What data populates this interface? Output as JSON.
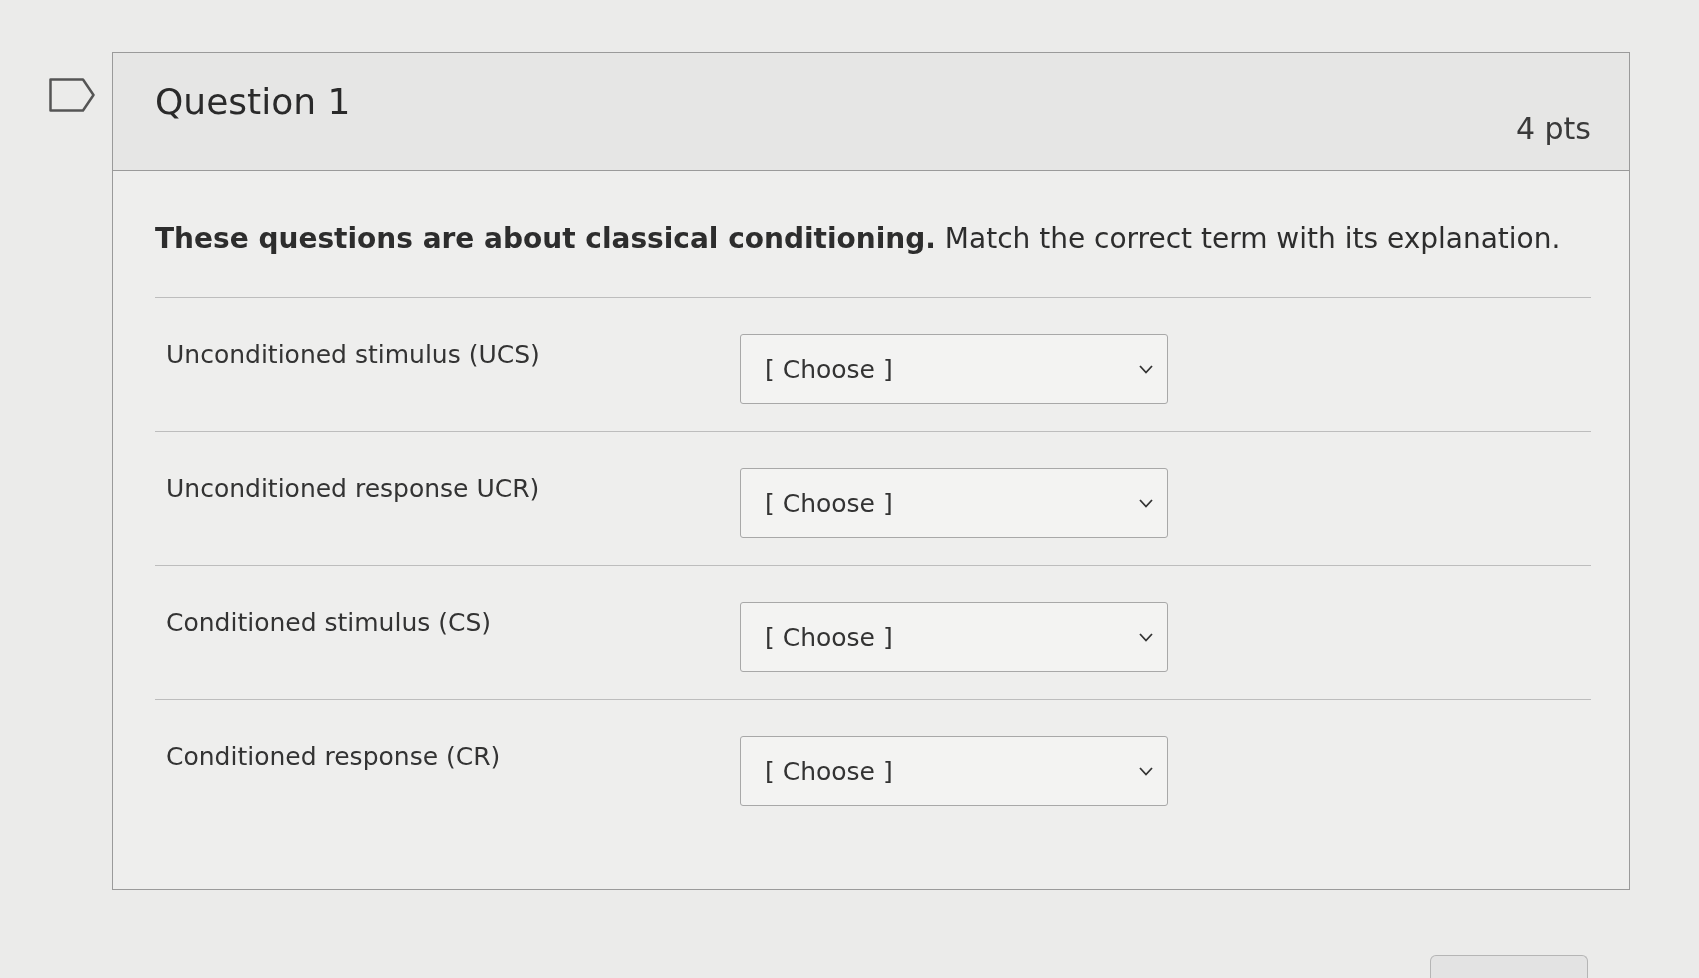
{
  "question": {
    "title": "Question 1",
    "points": "4 pts",
    "flagged": false
  },
  "prompt": "**These questions are about classical conditioning.** Match the correct term with its explanation.",
  "matches": [
    {
      "term": "Unconditioned stimulus (UCS)",
      "answer": "[ Choose ]"
    },
    {
      "term": "Unconditioned response UCR)",
      "answer": "[ Choose ]"
    },
    {
      "term": "Conditioned stimulus (CS)",
      "answer": "[ Choose ]"
    },
    {
      "term": "Conditioned response (CR)",
      "answer": "[ Choose ]"
    }
  ]
}
